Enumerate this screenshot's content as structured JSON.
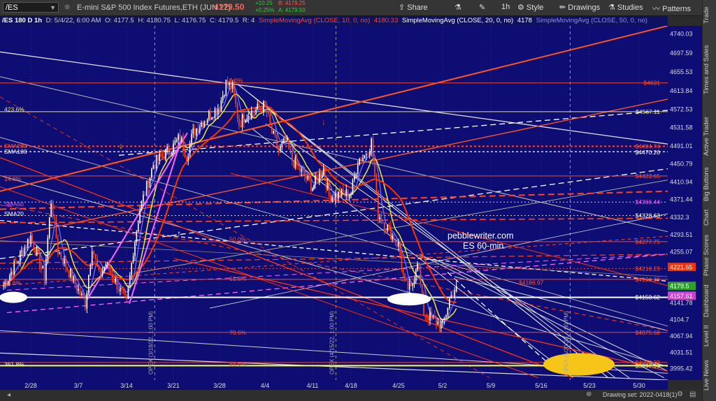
{
  "toolbar": {
    "symbol": "/ES",
    "title": "E-mini S&P 500 Index Futures,ETH (JUN 22)",
    "last": "4179.50",
    "change": "+10.25",
    "change_pct": "+0.25%",
    "bid": "B: 4179.25",
    "ask": "A: 4179.50",
    "share": "Share",
    "interval": "1h",
    "style": "Style",
    "drawings": "Drawings",
    "studies": "Studies",
    "patterns": "Patterns"
  },
  "infobar": {
    "sym": "/ES 180 D 1h",
    "date": "D: 5/4/22, 6:00 AM",
    "open": "O: 4177.5",
    "high": "H: 4180.75",
    "low": "L: 4176.75",
    "close": "C: 4179.5",
    "r": "R: 4",
    "sma10": "SimpleMovingAvg (CLOSE, 10, 0, no)",
    "sma10_val": "4180.33",
    "sma20": "SimpleMovingAvg (CLOSE, 20, 0, no)",
    "sma20_val": "4178",
    "sma50": "SimpleMovingAvg (CLOSE, 50, 0, no)"
  },
  "chart_annotations": {
    "watermark1": "pebblewriter.com",
    "watermark2": "ES 60-min",
    "levels_left": [
      {
        "text": "423.6%",
        "color": "#e8e070",
        "price": 4572
      },
      {
        "text": "SMA200",
        "color": "#ff5533",
        "price": 4491
      },
      {
        "text": "SMA100",
        "color": "#ffffff",
        "price": 4478
      },
      {
        "text": "14.6%",
        "color": "#ff6644",
        "price": 4418
      },
      {
        "text": "SMA50",
        "color": "#ee66ee",
        "price": 4362
      },
      {
        "text": "SMA20",
        "color": "#ffffff",
        "price": 4340
      },
      {
        "text": "23.6%",
        "color": "#ff6644",
        "price": 4186
      },
      {
        "text": "161.8%",
        "color": "#ffffff",
        "price": 4158
      },
      {
        "text": "361.8%",
        "color": "#ffff66",
        "price": 4005
      }
    ],
    "fib_labels": [
      {
        "text": "0.0%",
        "price": 4637
      },
      {
        "text": "50.0%",
        "price": 4283
      },
      {
        "text": "61.8%",
        "price": 4195
      },
      {
        "text": "78.6%",
        "price": 4076
      },
      {
        "text": "88.6%",
        "price": 4006
      }
    ],
    "right_labels": [
      {
        "text": "$4631",
        "color": "#ff5533",
        "price": 4631
      },
      {
        "text": "$4567.11",
        "color": "#eeee88",
        "price": 4567
      },
      {
        "text": "$4484.74",
        "color": "#ff5533",
        "price": 4490
      },
      {
        "text": "$4470.26",
        "color": "#ffffff",
        "price": 4477
      },
      {
        "text": "$4423.65",
        "color": "#ff5533",
        "price": 4424
      },
      {
        "text": "$4366.44",
        "color": "#ee66ee",
        "price": 4366
      },
      {
        "text": "$4328.63",
        "color": "#ffffff",
        "price": 4336
      },
      {
        "text": "$4277.75",
        "color": "#ff5533",
        "price": 4278
      },
      {
        "text": "$4218.23",
        "color": "#ff5533",
        "price": 4218
      },
      {
        "text": "$4194.38",
        "color": "#ff5533",
        "price": 4194
      },
      {
        "text": "$4153.62",
        "color": "#ffffff",
        "price": 4154
      },
      {
        "text": "$4075.69",
        "color": "#ff5533",
        "price": 4076
      },
      {
        "text": "$4008.32",
        "color": "#ff5533",
        "price": 4009
      },
      {
        "text": "$3997.93",
        "color": "#ffff66",
        "price": 4002
      }
    ],
    "mid_labels": [
      {
        "text": "$4186.97",
        "color": "#ff5533",
        "price": 4187
      }
    ],
    "opex": [
      {
        "text": "OPEX (3/18/22, 1:00 PM)"
      },
      {
        "text": "OPEX (4/15/22, 1:00 PM)"
      },
      {
        "text": "OPEX (5/20/22, 1:00 PM)"
      }
    ]
  },
  "price_axis": {
    "ticks": [
      "4740.03",
      "4697.59",
      "4655.53",
      "4613.84",
      "4572.53",
      "4531.58",
      "4491.01",
      "4450.79",
      "4410.94",
      "4371.44",
      "4332.3",
      "4293.51",
      "4255.07",
      "4216.97",
      "4179.5",
      "4141.78",
      "4104.7",
      "4067.94",
      "4031.51",
      "3995.42"
    ],
    "markers": [
      {
        "text": "4221.65",
        "bg": "#e8350f",
        "price": 4221.65
      },
      {
        "text": "4179.5",
        "bg": "#2aa02a",
        "price": 4179.5
      },
      {
        "text": "4157.61",
        "bg": "#cc44cc",
        "price": 4157.61
      }
    ]
  },
  "status": {
    "drawing_set": "Drawing set: 2022-0418(1)"
  },
  "side_tabs": [
    "Trade",
    "Times and Sales",
    "Active Trader",
    "Big Buttons",
    "Chart",
    "Phase Scores",
    "Dashboard",
    "Level II",
    "Live News"
  ],
  "chart_data": {
    "type": "candlestick",
    "symbol": "/ES",
    "interval": "1h",
    "x_ticks": [
      "2/28",
      "3/7",
      "3/14",
      "3/21",
      "3/28",
      "4/4",
      "4/11",
      "4/18",
      "4/25",
      "5/2",
      "5/9",
      "5/16",
      "5/23",
      "5/30"
    ],
    "ylim": [
      3970,
      4758
    ],
    "price_path": [
      [
        "2/24",
        4180
      ],
      [
        "2/28",
        4290
      ],
      [
        "3/2",
        4200
      ],
      [
        "3/3",
        4370
      ],
      [
        "3/4",
        4260
      ],
      [
        "3/7",
        4170
      ],
      [
        "3/8",
        4140
      ],
      [
        "3/9",
        4270
      ],
      [
        "3/10",
        4200
      ],
      [
        "3/11",
        4230
      ],
      [
        "3/14",
        4140
      ],
      [
        "3/15",
        4260
      ],
      [
        "3/16",
        4350
      ],
      [
        "3/17",
        4400
      ],
      [
        "3/18",
        4450
      ],
      [
        "3/21",
        4490
      ],
      [
        "3/22",
        4510
      ],
      [
        "3/23",
        4470
      ],
      [
        "3/24",
        4520
      ],
      [
        "3/25",
        4540
      ],
      [
        "3/28",
        4580
      ],
      [
        "3/29",
        4630
      ],
      [
        "3/30",
        4620
      ],
      [
        "3/31",
        4540
      ],
      [
        "4/1",
        4560
      ],
      [
        "4/4",
        4580
      ],
      [
        "4/5",
        4520
      ],
      [
        "4/6",
        4480
      ],
      [
        "4/7",
        4500
      ],
      [
        "4/8",
        4460
      ],
      [
        "4/11",
        4400
      ],
      [
        "4/12",
        4420
      ],
      [
        "4/13",
        4440
      ],
      [
        "4/14",
        4380
      ],
      [
        "4/18",
        4385
      ],
      [
        "4/19",
        4460
      ],
      [
        "4/20",
        4470
      ],
      [
        "4/21",
        4500
      ],
      [
        "4/22",
        4340
      ],
      [
        "4/25",
        4270
      ],
      [
        "4/26",
        4180
      ],
      [
        "4/27",
        4170
      ],
      [
        "4/28",
        4240
      ],
      [
        "4/29",
        4120
      ],
      [
        "5/2",
        4090
      ],
      [
        "5/3",
        4150
      ],
      [
        "5/4",
        4179.5
      ]
    ],
    "series": [
      {
        "name": "SimpleMovingAvg (CLOSE, 10, 0, no)",
        "last": 4180.33
      },
      {
        "name": "SimpleMovingAvg (CLOSE, 20, 0, no)",
        "last": 4178
      },
      {
        "name": "SimpleMovingAvg (CLOSE, 50, 0, no)"
      }
    ],
    "last_price": 4179.5
  },
  "colors": {
    "plot_bg": "#0d0d73",
    "up": "#ffffff",
    "sma10": "#7070ff",
    "sma20": "#e8e840",
    "sma50": "#ff3300",
    "fib": "#ff4422"
  }
}
